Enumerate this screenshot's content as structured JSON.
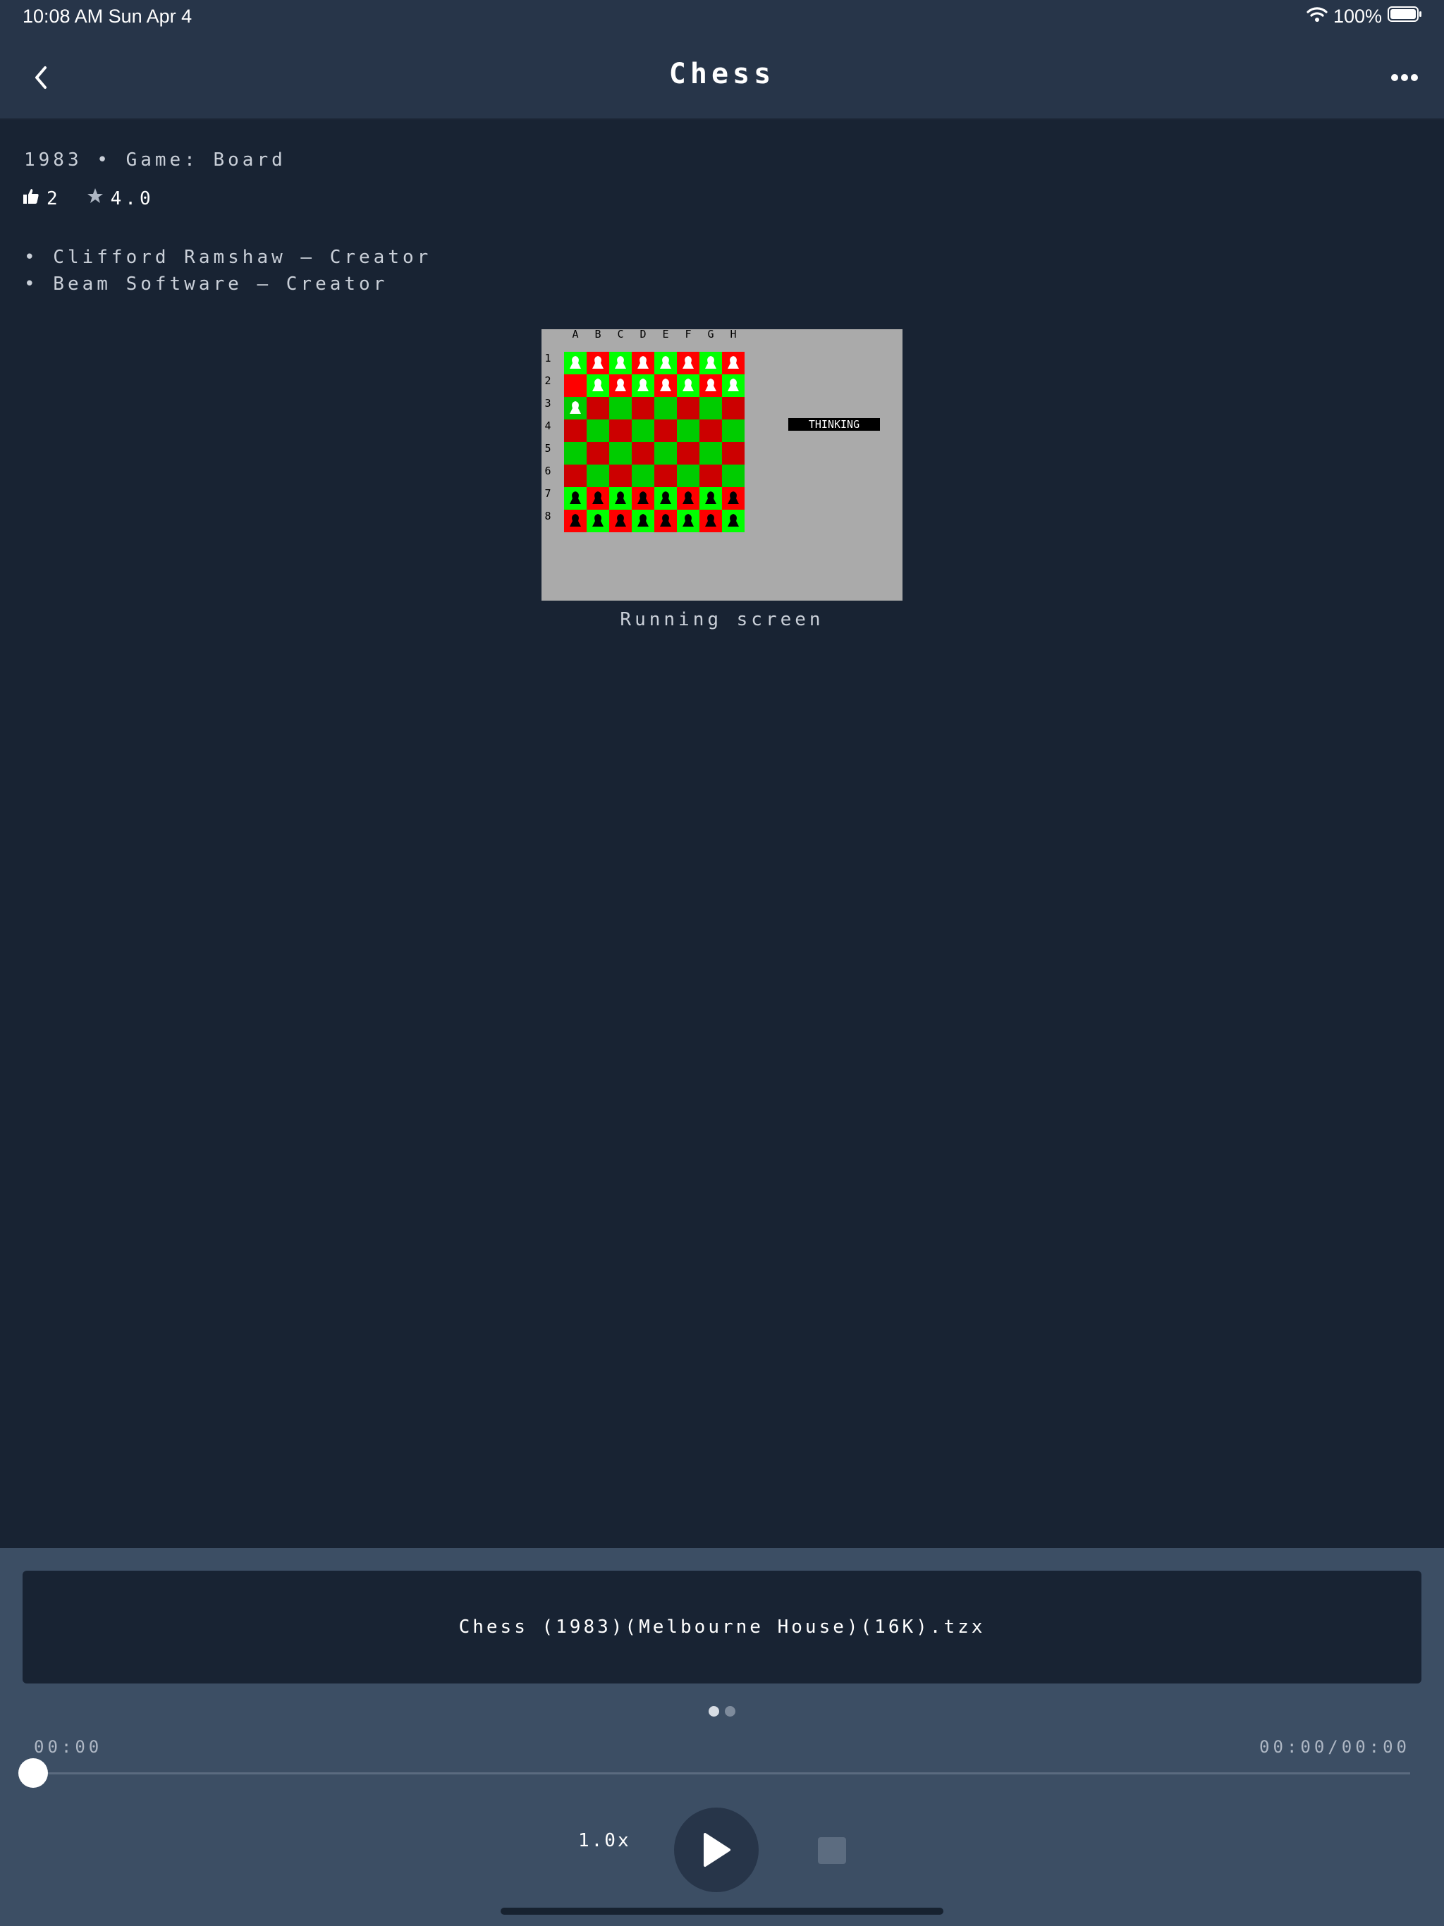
{
  "status_bar": {
    "time": "10:08 AM   Sun Apr 4",
    "battery": "100%"
  },
  "nav": {
    "title": "Chess"
  },
  "details": {
    "meta": "1983 • Game: Board",
    "likes": "2",
    "rating": "4.0",
    "credits": [
      "• Clifford Ramshaw – Creator",
      "• Beam Software – Creator"
    ]
  },
  "screenshot": {
    "columns": [
      "A",
      "B",
      "C",
      "D",
      "E",
      "F",
      "G",
      "H"
    ],
    "rows": [
      "1",
      "2",
      "3",
      "4",
      "5",
      "6",
      "7",
      "8"
    ],
    "status": "THINKING",
    "caption": "Running screen",
    "colors": {
      "background": "#aaaaaa",
      "light": "#00cc00",
      "dark": "#cc0000",
      "bright_light": "#00ff00",
      "bright_dark": "#ff0000"
    }
  },
  "player": {
    "file_name": "Chess (1983)(Melbourne House)(16K).tzx",
    "elapsed": "00:00",
    "total": "00:00/00:00",
    "speed": "1.0x",
    "progress": 0
  },
  "colors": {
    "background": "#182333",
    "bar": "#273549",
    "player": "#3c4e64"
  }
}
